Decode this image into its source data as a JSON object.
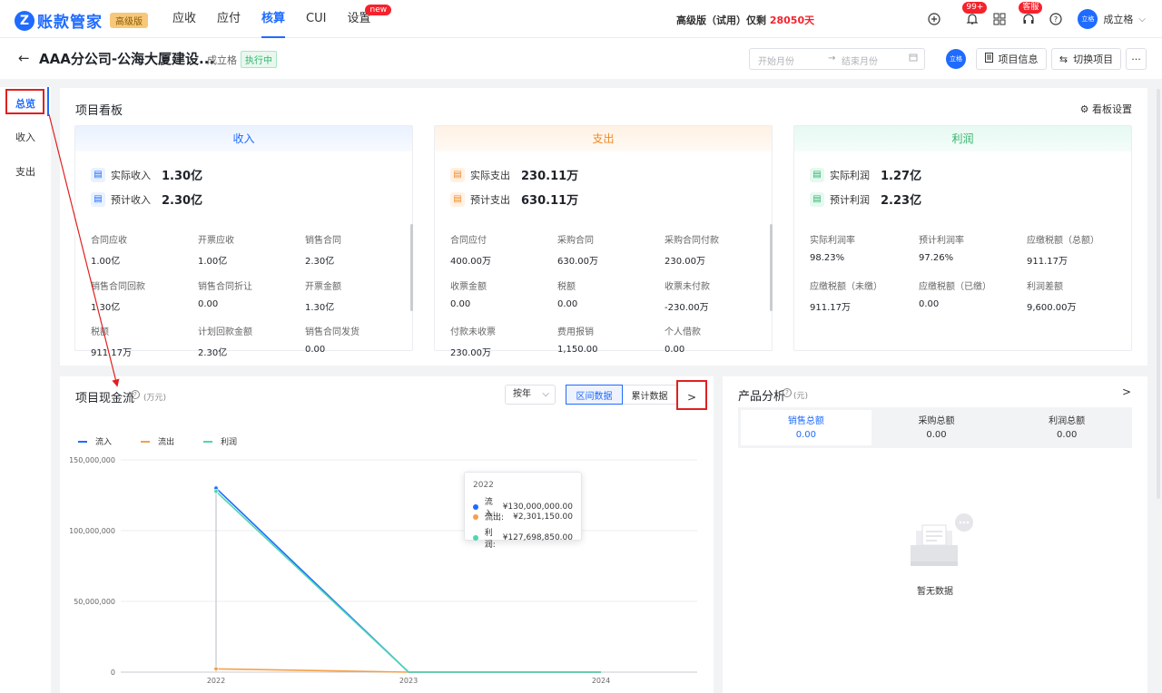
{
  "topbar": {
    "logo_letter": "Z",
    "logo_text": "账款管家",
    "edition_badge": "高级版",
    "nav": [
      {
        "label": "应收",
        "active": false
      },
      {
        "label": "应付",
        "active": false
      },
      {
        "label": "核算",
        "active": true
      },
      {
        "label": "CUI",
        "active": false
      },
      {
        "label": "设置",
        "active": false,
        "badge": "new"
      }
    ],
    "trial_prefix": "高级版（试用）仅剩",
    "trial_days": "28050天",
    "notification_badge": "99+",
    "service_badge": "客服",
    "avatar_text": "立格",
    "username": "成立格"
  },
  "subbar": {
    "project_title": "AAA分公司-公海大厦建设...",
    "owner": "成立格",
    "status": "执行中",
    "start_placeholder": "开始月份",
    "end_placeholder": "结束月份",
    "avatar_text": "立格",
    "btn_info": "项目信息",
    "btn_switch": "切换项目",
    "btn_more": "···"
  },
  "leftnav": [
    {
      "label": "总览",
      "active": true
    },
    {
      "label": "收入",
      "active": false
    },
    {
      "label": "支出",
      "active": false
    }
  ],
  "board": {
    "title": "项目看板",
    "settings": "看板设置",
    "columns": [
      {
        "name": "收入",
        "kpis": [
          {
            "label": "实际收入",
            "value": "1.30亿"
          },
          {
            "label": "预计收入",
            "value": "2.30亿"
          }
        ],
        "metrics": [
          {
            "label": "合同应收",
            "value": "1.00亿"
          },
          {
            "label": "开票应收",
            "value": "1.00亿"
          },
          {
            "label": "销售合同",
            "value": "2.30亿"
          },
          {
            "label": "销售合同回款",
            "value": "1.30亿"
          },
          {
            "label": "销售合同折让",
            "value": "0.00"
          },
          {
            "label": "开票金额",
            "value": "1.30亿"
          },
          {
            "label": "税额",
            "value": "911.17万"
          },
          {
            "label": "计划回款金额",
            "value": "2.30亿"
          },
          {
            "label": "销售合同发货",
            "value": "0.00"
          }
        ]
      },
      {
        "name": "支出",
        "kpis": [
          {
            "label": "实际支出",
            "value": "230.11万"
          },
          {
            "label": "预计支出",
            "value": "630.11万"
          }
        ],
        "metrics": [
          {
            "label": "合同应付",
            "value": "400.00万"
          },
          {
            "label": "采购合同",
            "value": "630.00万"
          },
          {
            "label": "采购合同付款",
            "value": "230.00万"
          },
          {
            "label": "收票金额",
            "value": "0.00"
          },
          {
            "label": "税额",
            "value": "0.00"
          },
          {
            "label": "收票未付款",
            "value": "-230.00万"
          },
          {
            "label": "付款未收票",
            "value": "230.00万"
          },
          {
            "label": "费用报销",
            "value": "1,150.00"
          },
          {
            "label": "个人借款",
            "value": "0.00"
          }
        ]
      },
      {
        "name": "利润",
        "kpis": [
          {
            "label": "实际利润",
            "value": "1.27亿"
          },
          {
            "label": "预计利润",
            "value": "2.23亿"
          }
        ],
        "metrics": [
          {
            "label": "实际利润率",
            "value": "98.23%"
          },
          {
            "label": "预计利润率",
            "value": "97.26%"
          },
          {
            "label": "应缴税额（总额）",
            "value": "911.17万"
          },
          {
            "label": "应缴税额（未缴）",
            "value": "911.17万"
          },
          {
            "label": "应缴税额（已缴）",
            "value": "0.00"
          },
          {
            "label": "利润差额",
            "value": "9,600.00万"
          }
        ]
      }
    ],
    "colors": {
      "income_head_bg": "#eaf2ff",
      "income_head_fg": "#1f6bff",
      "expense_head_bg": "#fff1e4",
      "expense_head_fg": "#f08a24",
      "profit_head_bg": "#e6f9f1",
      "profit_head_fg": "#2fb56a"
    }
  },
  "cashflow": {
    "title": "项目现金流",
    "unit": "(万元)",
    "period_select": "按年",
    "tab_interval": "区间数据",
    "tab_cumulative": "累计数据",
    "next": ">",
    "tooltip": {
      "year": "2022",
      "rows": [
        {
          "label": "流入:",
          "value": "¥130,000,000.00"
        },
        {
          "label": "流出:",
          "value": "¥2,301,150.00"
        },
        {
          "label": "利润:",
          "value": "¥127,698,850.00"
        }
      ]
    }
  },
  "chart_data": {
    "type": "line",
    "x": [
      "2022",
      "2023",
      "2024"
    ],
    "series": [
      {
        "name": "流入",
        "values": [
          130000000,
          0,
          0
        ],
        "color": "#1f6bff"
      },
      {
        "name": "流出",
        "values": [
          2301150,
          0,
          0
        ],
        "color": "#f5a04a"
      },
      {
        "name": "利润",
        "values": [
          127698850,
          0,
          0
        ],
        "color": "#4dd6b1"
      }
    ],
    "y_ticks": [
      "150,000,000",
      "100,000,000",
      "50,000,000",
      "0"
    ],
    "ylim": [
      0,
      150000000
    ],
    "grid": true,
    "legend": "top-left"
  },
  "product": {
    "title": "产品分析",
    "unit": "(元)",
    "next": ">",
    "tabs": [
      {
        "label": "销售总额",
        "value": "0.00",
        "active": true
      },
      {
        "label": "采购总额",
        "value": "0.00",
        "active": false
      },
      {
        "label": "利润总额",
        "value": "0.00",
        "active": false
      }
    ],
    "empty_text": "暂无数据"
  }
}
